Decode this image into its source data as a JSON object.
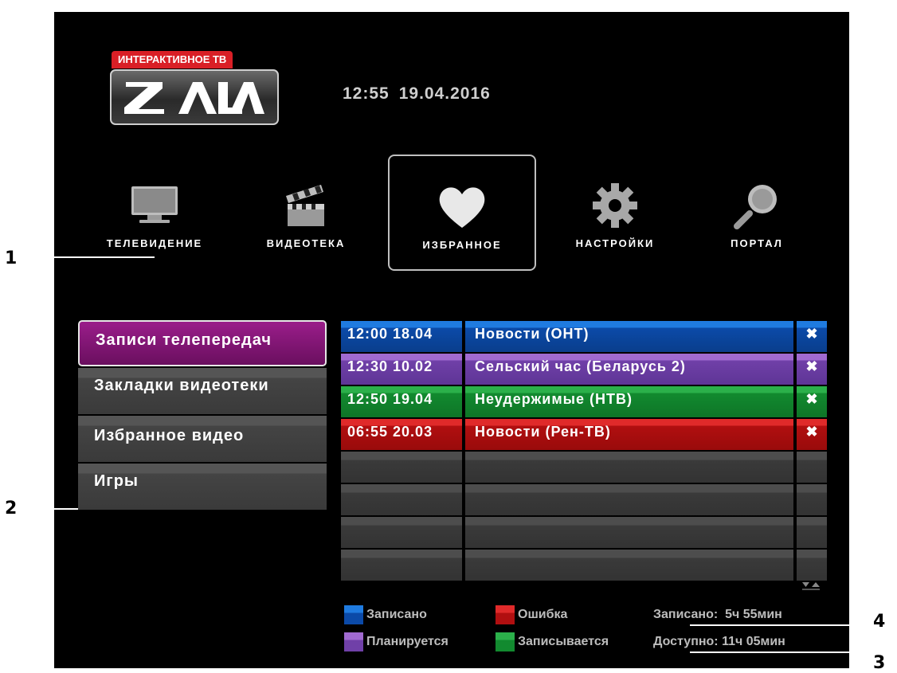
{
  "callouts": [
    "1",
    "2",
    "3",
    "4"
  ],
  "logo": {
    "badge": "ИНТЕРАКТИВНОЕ ТВ",
    "brand": "ZALA"
  },
  "datetime": {
    "time": "12:55",
    "date": "19.04.2016"
  },
  "nav": [
    {
      "label": "ТЕЛЕВИДЕНИЕ",
      "icon": "tv-icon"
    },
    {
      "label": "ВИДЕОТЕКА",
      "icon": "clapperboard-icon"
    },
    {
      "label": "ИЗБРАННОЕ",
      "icon": "heart-icon",
      "selected": true
    },
    {
      "label": "НАСТРОЙКИ",
      "icon": "gear-icon"
    },
    {
      "label": "ПОРТАЛ",
      "icon": "magnifier-icon"
    }
  ],
  "left_menu": [
    {
      "label": "Записи телепередач",
      "active": true
    },
    {
      "label": "Закладки видеотеки"
    },
    {
      "label": "Избранное видео"
    },
    {
      "label": "Игры"
    }
  ],
  "recordings": [
    {
      "time": "12:00 18.04",
      "title": "Новости (ОНТ)",
      "status": "blue"
    },
    {
      "time": "12:30 10.02",
      "title": "Сельский час (Беларусь 2)",
      "status": "purple"
    },
    {
      "time": "12:50 19.04",
      "title": "Неудержимые (НТВ)",
      "status": "green"
    },
    {
      "time": "06:55 20.03",
      "title": "Новости (Рен-ТВ)",
      "status": "red"
    }
  ],
  "delete_glyph": "✖",
  "legend": {
    "recorded": "Записано",
    "error": "Ошибка",
    "planned": "Планируется",
    "recording": "Записывается"
  },
  "stats": {
    "recorded": "Записано:  5ч 55мин",
    "available": "Доступно: 11ч 05мин"
  },
  "colors": {
    "recorded": "#0b4aa8",
    "planned": "#7040a8",
    "recording": "#128a2f",
    "error": "#b10f10",
    "active_menu": "#7a1370"
  }
}
